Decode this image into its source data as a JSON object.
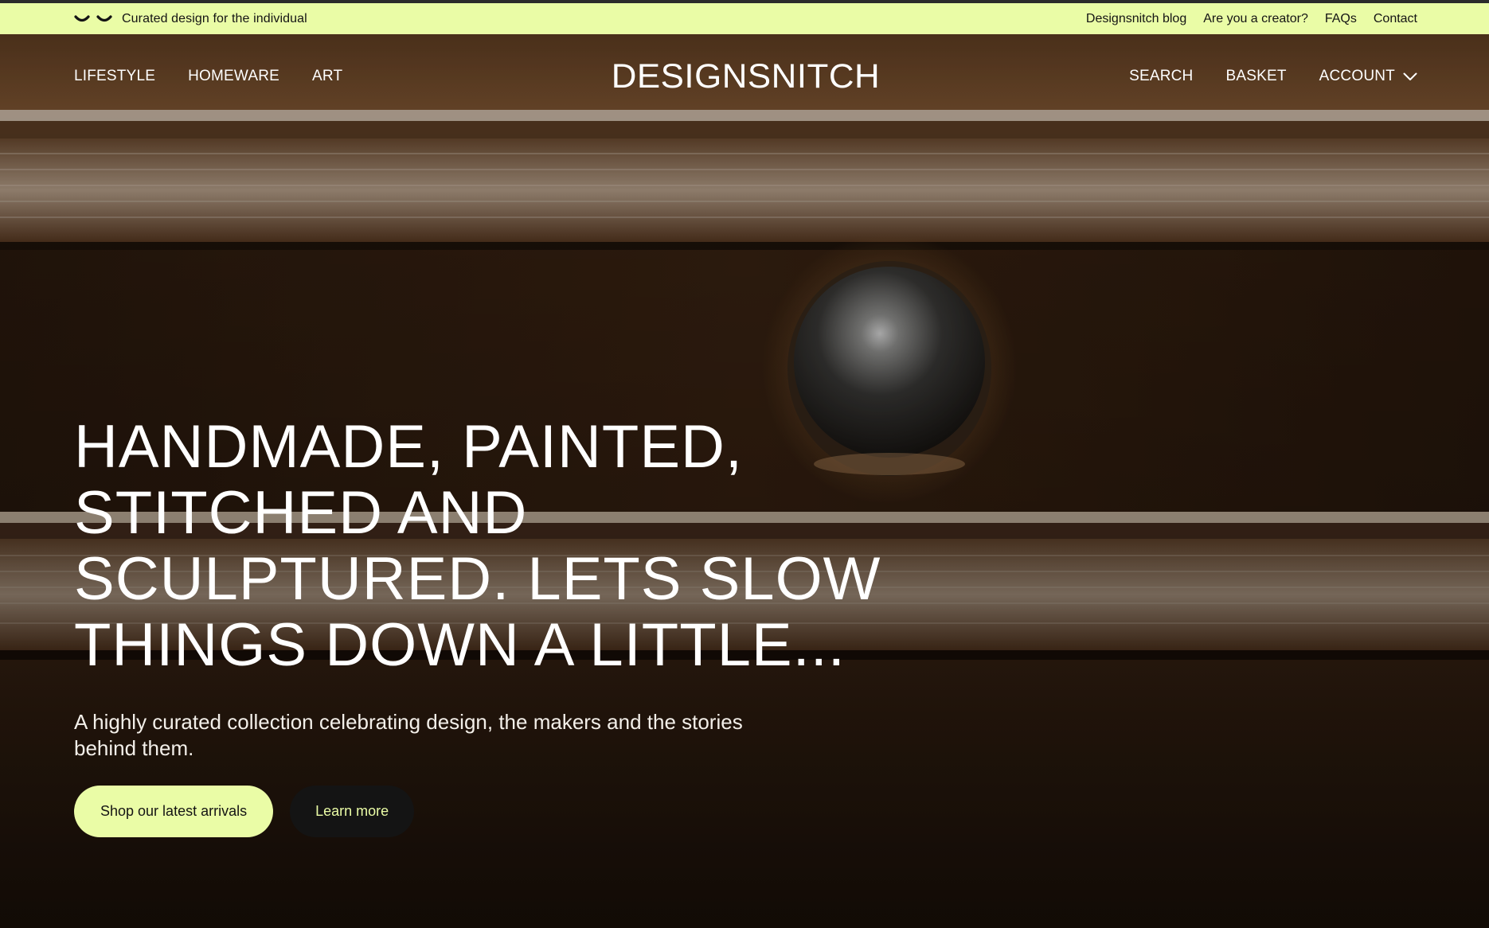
{
  "topbar": {
    "logo_icon": "smile-eyes-icon",
    "tagline": "Curated design for the individual",
    "links": [
      "Designsnitch blog",
      "Are you a creator?",
      "FAQs",
      "Contact"
    ]
  },
  "nav": {
    "left": [
      "LIFESTYLE",
      "HOMEWARE",
      "ART"
    ],
    "brand": "DESIGNSNITCH",
    "right": {
      "search": "SEARCH",
      "basket": "BASKET",
      "account": "ACCOUNT",
      "account_icon": "chevron-down-icon"
    }
  },
  "hero": {
    "headline_lines": [
      "HANDMADE, PAINTED,",
      "STITCHED AND",
      "SCULPTURED. LETS SLOW",
      "THINGS DOWN A LITTLE..."
    ],
    "subhead": "A highly curated collection celebrating design, the makers and the stories behind them.",
    "primary_cta": "Shop our latest arrivals",
    "secondary_cta": "Learn more"
  },
  "colors": {
    "accent": "#eafca6",
    "dark": "#141414",
    "text_light": "#ffffff"
  }
}
